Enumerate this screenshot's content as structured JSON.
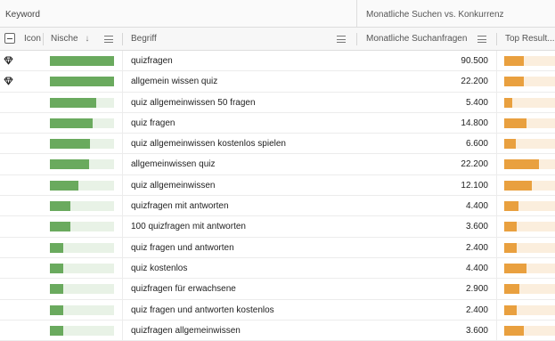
{
  "header_groups": {
    "keyword": "Keyword",
    "monthly": "Monatliche Suchen vs. Konkurrenz"
  },
  "columns": {
    "icon": "Icon",
    "nische": "Nische",
    "sort_arrow": "↓",
    "begriff": "Begriff",
    "volume": "Monatliche Suchanfragen",
    "top": "Top Result..."
  },
  "colors": {
    "nische_bar": "#6aaa5e",
    "nische_track": "#e8f2e6",
    "top_bar": "#e9a03f",
    "top_track": "#fbeedd"
  },
  "rows": [
    {
      "icon": "diamond-icon",
      "begriff": "quizfragen",
      "volume": "90.500",
      "nische_pct": 100,
      "top_pct": 38
    },
    {
      "icon": "diamond-icon",
      "begriff": "allgemein wissen quiz",
      "volume": "22.200",
      "nische_pct": 100,
      "top_pct": 38
    },
    {
      "icon": "",
      "begriff": "quiz allgemeinwissen 50 fragen",
      "volume": "5.400",
      "nische_pct": 72,
      "top_pct": 16
    },
    {
      "icon": "",
      "begriff": "quiz fragen",
      "volume": "14.800",
      "nische_pct": 67,
      "top_pct": 44
    },
    {
      "icon": "",
      "begriff": "quiz allgemeinwissen kostenlos spielen",
      "volume": "6.600",
      "nische_pct": 63,
      "top_pct": 22
    },
    {
      "icon": "",
      "begriff": "allgemeinwissen quiz",
      "volume": "22.200",
      "nische_pct": 61,
      "top_pct": 68
    },
    {
      "icon": "",
      "begriff": "quiz allgemeinwissen",
      "volume": "12.100",
      "nische_pct": 45,
      "top_pct": 55
    },
    {
      "icon": "",
      "begriff": "quizfragen mit antworten",
      "volume": "4.400",
      "nische_pct": 32,
      "top_pct": 28
    },
    {
      "icon": "",
      "begriff": "100 quizfragen mit antworten",
      "volume": "3.600",
      "nische_pct": 32,
      "top_pct": 24
    },
    {
      "icon": "",
      "begriff": "quiz fragen und antworten",
      "volume": "2.400",
      "nische_pct": 21,
      "top_pct": 24
    },
    {
      "icon": "",
      "begriff": "quiz kostenlos",
      "volume": "4.400",
      "nische_pct": 21,
      "top_pct": 44
    },
    {
      "icon": "",
      "begriff": "quizfragen für erwachsene",
      "volume": "2.900",
      "nische_pct": 21,
      "top_pct": 30
    },
    {
      "icon": "",
      "begriff": "quiz fragen und antworten kostenlos",
      "volume": "2.400",
      "nische_pct": 21,
      "top_pct": 24
    },
    {
      "icon": "",
      "begriff": "quizfragen allgemeinwissen",
      "volume": "3.600",
      "nische_pct": 21,
      "top_pct": 38
    }
  ]
}
